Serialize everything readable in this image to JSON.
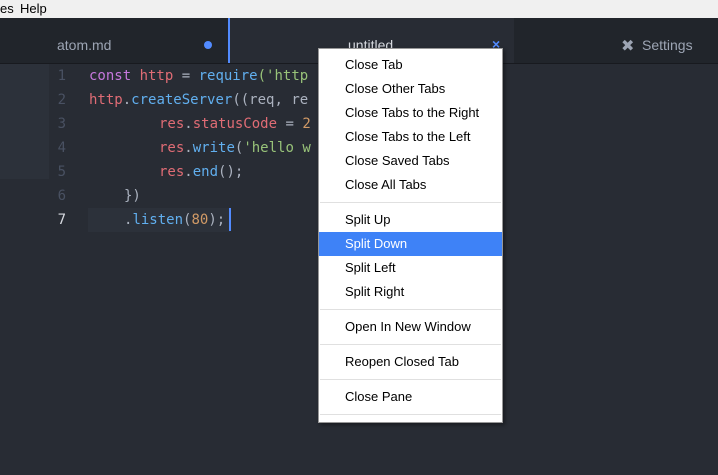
{
  "menubar": {
    "items": [
      "es",
      "Help"
    ]
  },
  "tabs": [
    {
      "label": "atom.md",
      "modified": true
    },
    {
      "label": "untitled",
      "active": true
    },
    {
      "label": "Settings",
      "icon": "tools-icon"
    }
  ],
  "editor": {
    "lines": [
      {
        "n": "1"
      },
      {
        "n": "2"
      },
      {
        "n": "3"
      },
      {
        "n": "4"
      },
      {
        "n": "5"
      },
      {
        "n": "6"
      },
      {
        "n": "7"
      }
    ],
    "code": [
      [
        "const ",
        "http",
        " = ",
        "require",
        "('http"
      ],
      [
        "http",
        ".",
        "createServer",
        "((req, re"
      ],
      [
        "res",
        ".",
        "statusCode",
        " = ",
        "2"
      ],
      [
        "res",
        ".",
        "write",
        "(",
        "'hello w"
      ],
      [
        "res",
        ".",
        "end",
        "();"
      ],
      [
        "})"
      ],
      [
        ".",
        "listen",
        "(",
        "80",
        ");"
      ]
    ]
  },
  "context_menu": {
    "items": [
      "Close Tab",
      "Close Other Tabs",
      "Close Tabs to the Right",
      "Close Tabs to the Left",
      "Close Saved Tabs",
      "Close All Tabs",
      "Split Up",
      "Split Down",
      "Split Left",
      "Split Right",
      "Open In New Window",
      "Reopen Closed Tab",
      "Close Pane"
    ],
    "highlighted": "Split Down"
  },
  "colors": {
    "accent": "#528bff",
    "highlight": "#3e82f7",
    "editor_bg": "#282c34"
  }
}
